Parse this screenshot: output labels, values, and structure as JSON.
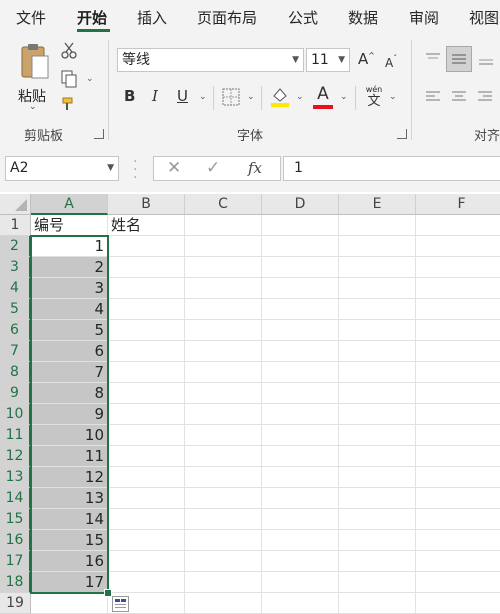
{
  "tabs": [
    "文件",
    "开始",
    "插入",
    "页面布局",
    "公式",
    "数据",
    "审阅",
    "视图"
  ],
  "ribbon": {
    "clipboard": {
      "paste_label": "粘贴",
      "group_label": "剪贴板"
    },
    "font": {
      "font_name": "等线",
      "font_size": "11",
      "group_label": "字体",
      "bold": "B",
      "italic": "I",
      "underline": "U",
      "font_color_letter": "A",
      "phonetic_top": "wén",
      "phonetic_bottom": "文",
      "grow": "A",
      "shrink": "A"
    },
    "alignment": {
      "group_label": "对齐"
    }
  },
  "formula_bar": {
    "name_box": "A2",
    "fx": "fx",
    "value": "1"
  },
  "colors": {
    "accent": "#217346",
    "font_color_bar": "#e81123",
    "highlight_bar": "#ffe600"
  },
  "sheet": {
    "columns": [
      "A",
      "B",
      "C",
      "D",
      "E",
      "F"
    ],
    "rows": [
      "1",
      "2",
      "3",
      "4",
      "5",
      "6",
      "7",
      "8",
      "9",
      "10",
      "11",
      "12",
      "13",
      "14",
      "15",
      "16",
      "17",
      "18",
      "19"
    ],
    "header": {
      "A": "编号",
      "B": "姓名"
    },
    "values": [
      "1",
      "2",
      "3",
      "4",
      "5",
      "6",
      "7",
      "8",
      "9",
      "10",
      "11",
      "12",
      "13",
      "14",
      "15",
      "16",
      "17"
    ]
  }
}
